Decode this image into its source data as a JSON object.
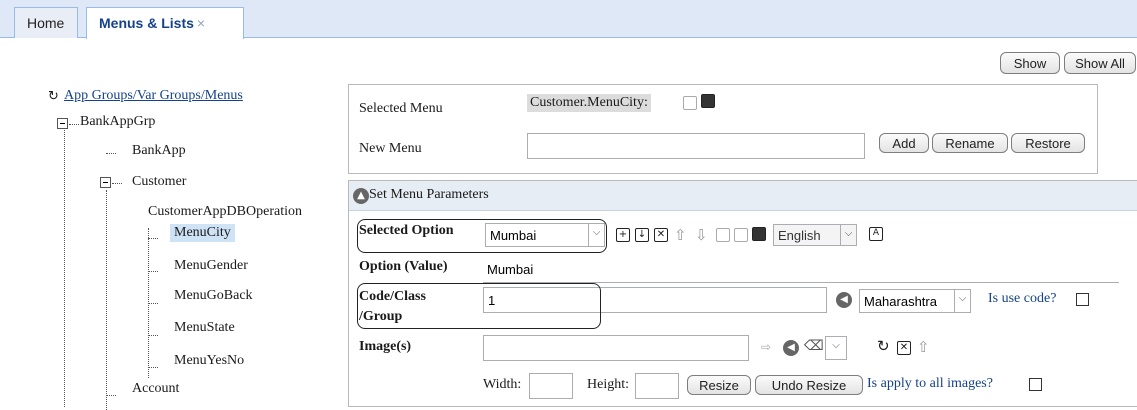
{
  "tabs": {
    "home": "Home",
    "active": "Menus & Lists",
    "close": "×"
  },
  "toolbar": {
    "show": "Show",
    "show_all": "Show All"
  },
  "tree": {
    "root": "App Groups/Var Groups/Menus",
    "group": "BankAppGrp",
    "bankapp": "BankApp",
    "customer": "Customer",
    "db_operation": "CustomerAppDBOperation",
    "menus": [
      "MenuCity",
      "MenuGender",
      "MenuGoBack",
      "MenuState",
      "MenuYesNo"
    ],
    "account": "Account"
  },
  "menu_panel": {
    "selected_menu_label": "Selected Menu",
    "selected_menu_value": "Customer.MenuCity:",
    "new_menu_label": "New Menu",
    "new_menu_value": "",
    "add": "Add",
    "rename": "Rename",
    "restore": "Restore"
  },
  "params": {
    "header": "Set Menu Parameters",
    "selected_option_label": "Selected Option",
    "selected_option_value": "Mumbai",
    "language": "English",
    "option_value_label": "Option (Value)",
    "option_value": "Mumbai",
    "code_label_1": "Code/Class",
    "code_label_2": "/Group",
    "code_value": "1",
    "state_value": "Maharashtra",
    "is_use_code": "Is use code?",
    "images_label": "Image(s)",
    "width_label": "Width:",
    "height_label": "Height:",
    "resize": "Resize",
    "undo_resize": "Undo Resize",
    "apply_all": "Is apply to all images?"
  },
  "colors": {
    "tab_bg": "#dfe8f6",
    "link": "#15428b",
    "selected_bg": "#cfe3f7",
    "header_bg": "#e7edf5"
  }
}
